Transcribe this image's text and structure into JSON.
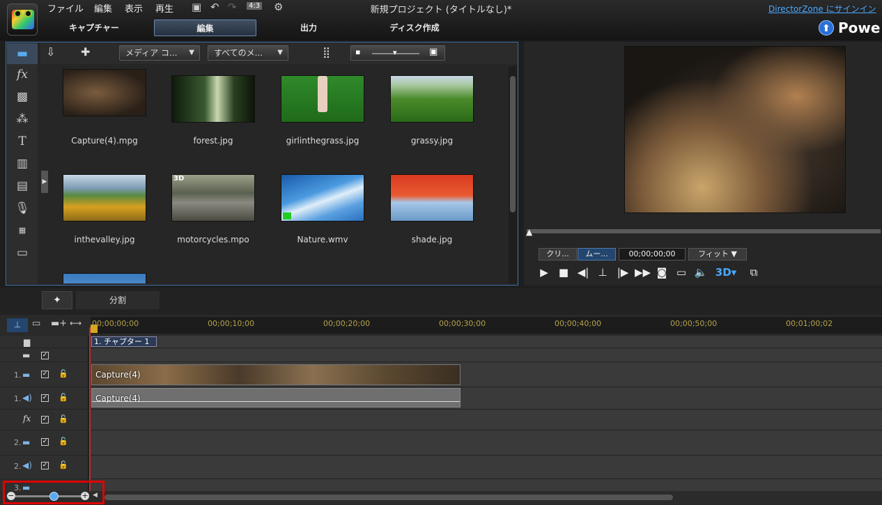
{
  "menu": {
    "file": "ファイル",
    "edit": "編集",
    "view": "表示",
    "play": "再生"
  },
  "aspect": "4:3",
  "window_title": "新規プロジェクト (タイトルなし)*",
  "director_zone": "DirectorZone にサインイン",
  "main_tabs": {
    "capture": "キャプチャー",
    "edit": "編集",
    "output": "出力",
    "disc": "ディスク作成"
  },
  "brand": "Powe",
  "library": {
    "filter_media": "メディア コ...",
    "filter_all": "すべてのメ...",
    "items": [
      {
        "name": "Capture(4).mpg"
      },
      {
        "name": "forest.jpg"
      },
      {
        "name": "girlinthegrass.jpg"
      },
      {
        "name": "grassy.jpg"
      },
      {
        "name": "inthevalley.jpg"
      },
      {
        "name": "motorcycles.mpo",
        "badge": "3D"
      },
      {
        "name": "Nature.wmv"
      },
      {
        "name": "shade.jpg"
      }
    ]
  },
  "preview": {
    "clip_btn": "クリ...",
    "movie_btn": "ムー...",
    "timecode": "00;00;00;00",
    "fit": "フィット"
  },
  "mid": {
    "split": "分割"
  },
  "ruler": [
    "00;00;00;00",
    "00;00;10;00",
    "00;00;20;00",
    "00;00;30;00",
    "00;00;40;00",
    "00;00;50;00",
    "00;01;00;02"
  ],
  "tracks": {
    "chapter": "1. チャプター 1",
    "video1_clip": "Capture(4)",
    "audio1_clip": "Capture(4)",
    "v1": "1.",
    "a1": "1.",
    "v2": "2.",
    "a2": "2.",
    "v3": "3."
  },
  "colors": {
    "accent": "#3d6fa8",
    "highlight": "#e00000"
  }
}
